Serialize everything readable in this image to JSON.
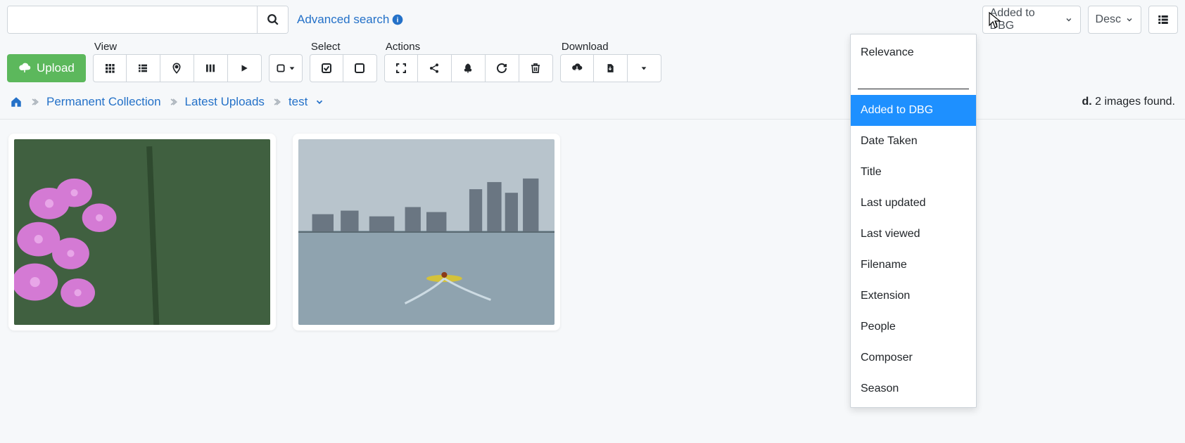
{
  "search": {
    "placeholder": ""
  },
  "advanced_search": {
    "label": "Advanced search"
  },
  "upload": {
    "label": "Upload"
  },
  "toolbar": {
    "view": {
      "label": "View"
    },
    "select": {
      "label": "Select"
    },
    "actions": {
      "label": "Actions"
    },
    "download": {
      "label": "Download"
    }
  },
  "sort_control": {
    "selected": "Added to DBG",
    "direction": "Desc",
    "options": [
      "Relevance",
      "Added to DBG",
      "Date Taken",
      "Title",
      "Last updated",
      "Last viewed",
      "Filename",
      "Extension",
      "People",
      "Composer",
      "Season"
    ],
    "active_index": 1,
    "filter_value": ""
  },
  "breadcrumbs": {
    "items": [
      "Permanent Collection",
      "Latest Uploads",
      "test"
    ]
  },
  "status": {
    "bold_suffix": "d.",
    "count": "2",
    "tail": " images found."
  },
  "thumbnails": [
    {
      "name": "flowers-thumbnail"
    },
    {
      "name": "lake-kayak-thumbnail"
    }
  ]
}
